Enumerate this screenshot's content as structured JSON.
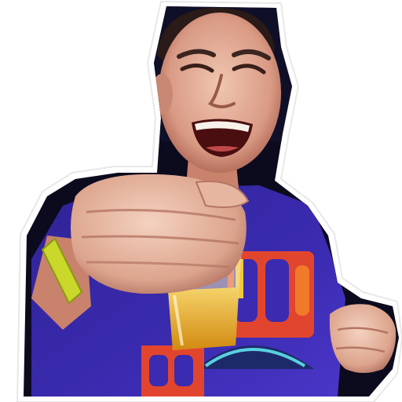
{
  "scene": {
    "subject": "laughing-man-holding-drink",
    "colors": {
      "background": "#ffffff",
      "sticker_border": "#ffffff",
      "dark_background": "#0c0b1e",
      "skin": "#d99a84",
      "skin_highlight": "#f0c6b2",
      "skin_shadow": "#a9604e",
      "hair": "#2a1a18",
      "shirt": "#3a2bb0",
      "shirt_print_red": "#e2452e",
      "shirt_print_orange": "#f07a2a",
      "shirt_print_yellow": "#f1c83a",
      "wristband": "#c9d82a",
      "drink": "#e3a21a",
      "glass": "#f1e6b8"
    }
  }
}
